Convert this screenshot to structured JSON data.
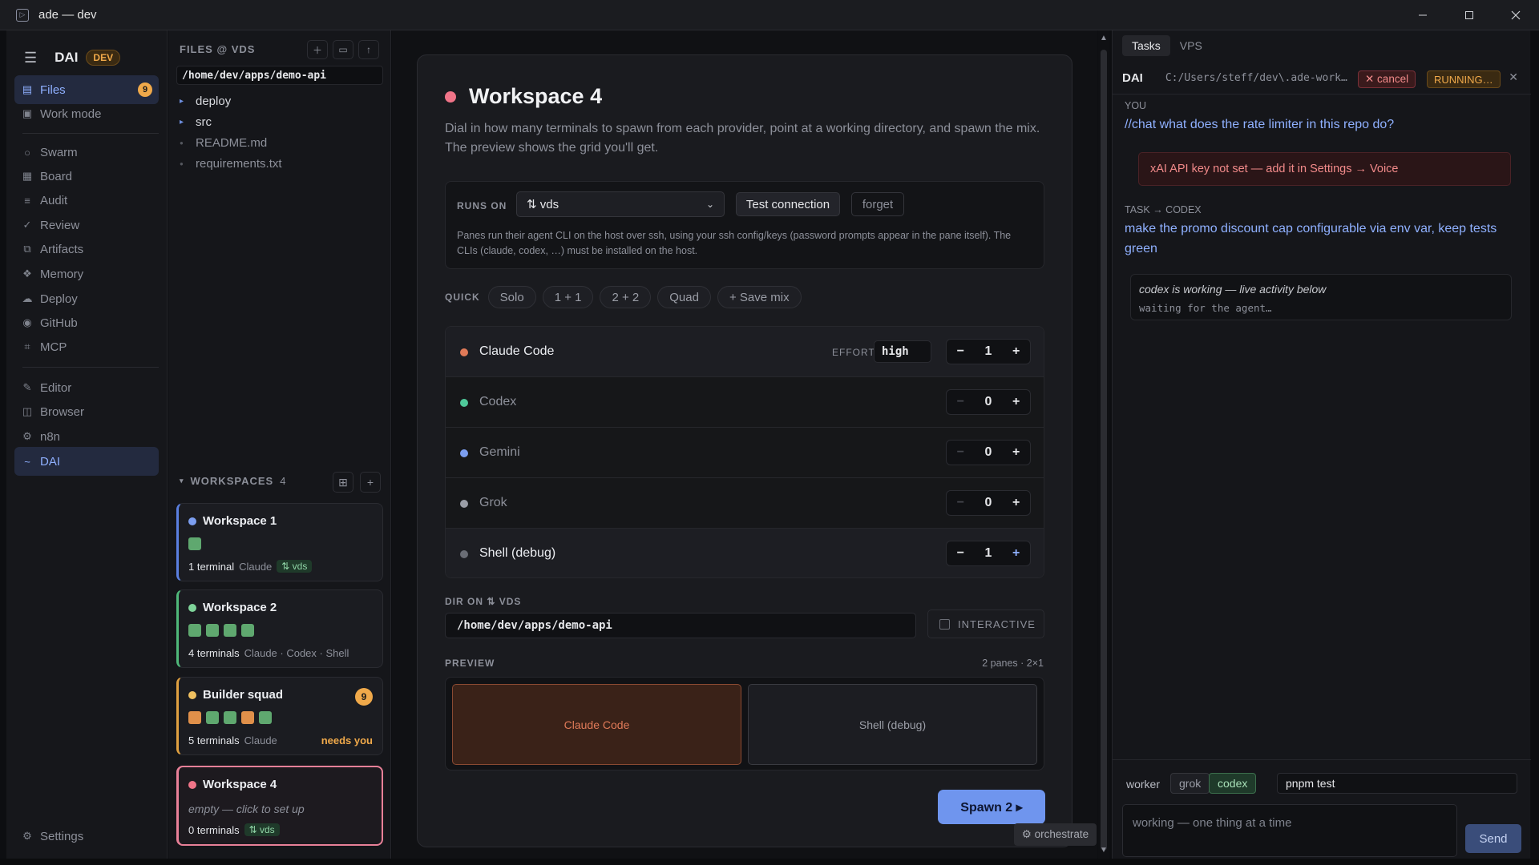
{
  "window": {
    "title": "ade — dev"
  },
  "nav": {
    "brand": "DAI",
    "env_badge": "DEV",
    "files_count": "9",
    "items": [
      "Files",
      "Work mode",
      "Swarm",
      "Board",
      "Audit",
      "Review",
      "Artifacts",
      "Memory",
      "Deploy",
      "GitHub",
      "MCP",
      "Editor",
      "Browser",
      "n8n",
      "DAI"
    ],
    "settings": "Settings"
  },
  "files": {
    "header": "FILES @ VDS",
    "path": "/home/dev/apps/demo-api",
    "folders": [
      "deploy",
      "src"
    ],
    "file_list": [
      "README.md",
      "requirements.txt"
    ]
  },
  "workspaces": {
    "header": "WORKSPACES",
    "count": "4",
    "cards": [
      {
        "name": "Workspace 1",
        "terminals": "1 terminal",
        "providers": "Claude",
        "host": "⇅ vds"
      },
      {
        "name": "Workspace 2",
        "terminals": "4 terminals",
        "providers": "Claude · Codex · Shell"
      },
      {
        "name": "Builder squad",
        "badge": "9",
        "terminals": "5 terminals",
        "providers": "Claude",
        "status": "needs you"
      },
      {
        "name": "Workspace 4",
        "empty": "empty — click to set up",
        "terminals": "0 terminals",
        "host": "⇅ vds"
      }
    ]
  },
  "modal": {
    "title": "Workspace 4",
    "description": "Dial in how many terminals to spawn from each provider, point at a working directory, and spawn the mix. The preview shows the grid you'll get.",
    "runs_on_label": "RUNS ON",
    "runs_on_value": "⇅ vds",
    "test_connection": "Test connection",
    "forget": "forget",
    "runs_note": "Panes run their agent CLI on the host over ssh, using your ssh config/keys (password prompts appear in the pane itself). The CLIs (claude, codex, …) must be installed on the host.",
    "quick_label": "QUICK",
    "quick": [
      "Solo",
      "1 + 1",
      "2 + 2",
      "Quad",
      "+ Save mix"
    ],
    "effort_label": "EFFORT",
    "effort_value": "high",
    "providers": [
      {
        "name": "Claude Code",
        "count": "1",
        "color": "#e07a58"
      },
      {
        "name": "Codex",
        "count": "0",
        "color": "#4fc99a"
      },
      {
        "name": "Gemini",
        "count": "0",
        "color": "#7c9ef0"
      },
      {
        "name": "Grok",
        "count": "0",
        "color": "#9a9da6"
      },
      {
        "name": "Shell (debug)",
        "count": "1",
        "color": "#6a6d75"
      }
    ],
    "dir_label": "DIR ON ⇅ VDS",
    "dir_value": "/home/dev/apps/demo-api",
    "interactive": "INTERACTIVE",
    "preview_label": "PREVIEW",
    "preview_info": "2 panes · 2×1",
    "panes": [
      "Claude Code",
      "Shell (debug)"
    ],
    "spawn": "Spawn 2 ▸",
    "orchestrate": "⚙ orchestrate"
  },
  "right": {
    "tabs": [
      "Tasks",
      "VPS"
    ],
    "agent": "DAI",
    "path": "C:/Users/steff/dev\\.ade-work…",
    "cancel": "✕ cancel",
    "status": "RUNNING…",
    "you_label": "YOU",
    "you_msg": "//chat what does the rate limiter in this repo do?",
    "error": "xAI API key not set — add it in Settings → Voice",
    "task_label": "TASK → CODEX",
    "task_msg": "make the promo discount cap configurable via env var, keep tests green",
    "working_title": "codex is working — live activity below",
    "working_sub": "waiting for the agent…",
    "worker_label": "worker",
    "workers": [
      "grok",
      "codex"
    ],
    "command": "pnpm test",
    "textarea_placeholder": "working — one thing at a time",
    "send": "Send"
  }
}
